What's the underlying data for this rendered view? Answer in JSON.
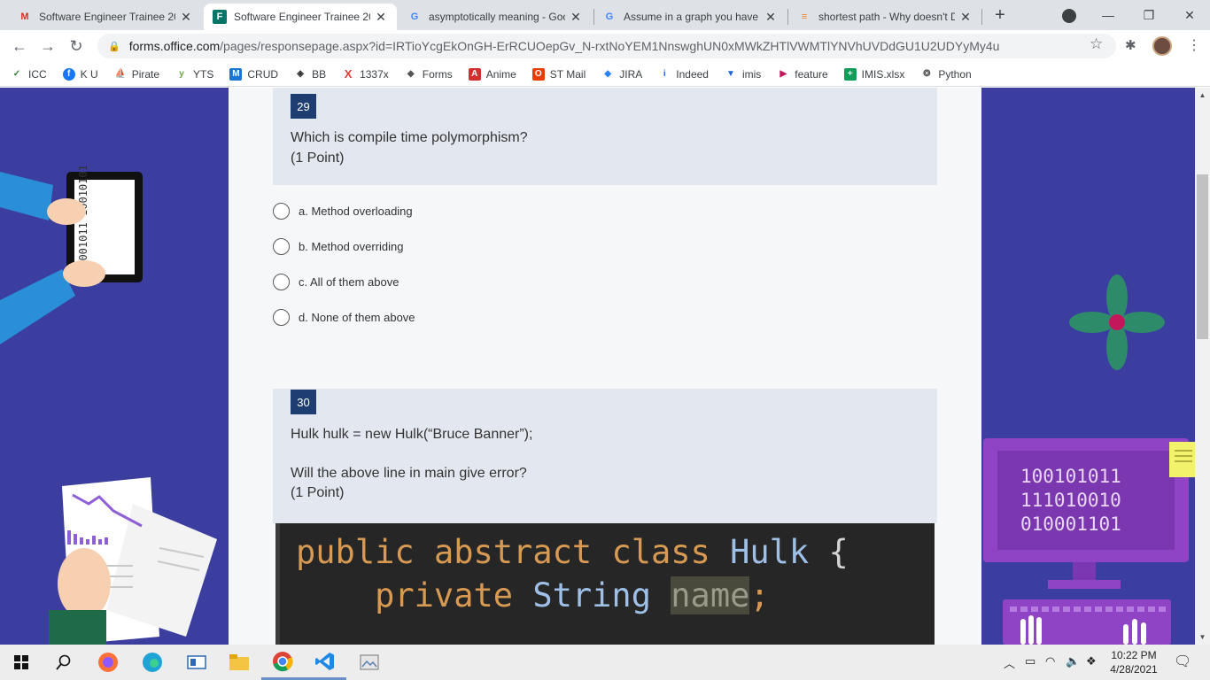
{
  "browser": {
    "tabs": [
      {
        "title": "Software Engineer Trainee 20",
        "favicon": "gmail-icon",
        "active": false
      },
      {
        "title": "Software Engineer Trainee 20",
        "favicon": "forms-icon",
        "active": true
      },
      {
        "title": "asymptotically meaning - Goo",
        "favicon": "google-icon",
        "active": false
      },
      {
        "title": "Assume in a graph you have",
        "favicon": "google-icon",
        "active": false
      },
      {
        "title": "shortest path - Why doesn't D",
        "favicon": "stackoverflow-icon",
        "active": false
      }
    ],
    "url_host": "forms.office.com",
    "url_path": "/pages/responsepage.aspx?id=IRTioYcgEkOnGH-ErRCUOepGv_N-rxtNoYEM1NnswghUN0xMWkZHTlVWMTlYNVhUVDdGU1U2UDYyMy4u",
    "bookmarks": [
      {
        "label": "ICC",
        "icon": "icc-icon"
      },
      {
        "label": "K U",
        "icon": "facebook-icon"
      },
      {
        "label": "Pirate",
        "icon": "pirate-icon"
      },
      {
        "label": "YTS",
        "icon": "yts-icon"
      },
      {
        "label": "CRUD",
        "icon": "crud-icon"
      },
      {
        "label": "BB",
        "icon": "bb-icon"
      },
      {
        "label": "1337x",
        "icon": "x-icon"
      },
      {
        "label": "Forms",
        "icon": "forms-icon"
      },
      {
        "label": "Anime",
        "icon": "anime-icon"
      },
      {
        "label": "ST Mail",
        "icon": "office-icon"
      },
      {
        "label": "JIRA",
        "icon": "jira-icon"
      },
      {
        "label": "Indeed",
        "icon": "indeed-icon"
      },
      {
        "label": "imis",
        "icon": "imis-icon"
      },
      {
        "label": "feature",
        "icon": "feature-icon"
      },
      {
        "label": "IMIS.xlsx",
        "icon": "sheets-icon"
      },
      {
        "label": "Python",
        "icon": "python-icon"
      }
    ]
  },
  "form": {
    "q29": {
      "number": "29",
      "text": "Which is compile time polymorphism?",
      "points": "(1 Point)",
      "options": [
        "a. Method overloading",
        "b. Method overriding",
        "c. All of them above",
        "d. None of them above"
      ]
    },
    "q30": {
      "number": "30",
      "text_line1": "Hulk hulk = new Hulk(“Bruce Banner”);",
      "text_line2": "Will the above line in main give error?",
      "points": "(1 Point)",
      "code_line1": [
        "public",
        "abstract",
        "class",
        "Hulk",
        "{"
      ],
      "code_line2": [
        "private",
        "String",
        "name",
        ";"
      ]
    }
  },
  "decor": {
    "binary_left": "10001011 10010101",
    "binary_right": [
      "100101011",
      "111010010",
      "010001101"
    ]
  },
  "taskbar": {
    "time": "10:22 PM",
    "date": "4/28/2021"
  },
  "colors": {
    "page_bg": "#3b3e9f",
    "question_number_bg": "#1e3d70",
    "form_bg": "#f5f7f9",
    "question_header_bg": "#e3e7ef"
  }
}
